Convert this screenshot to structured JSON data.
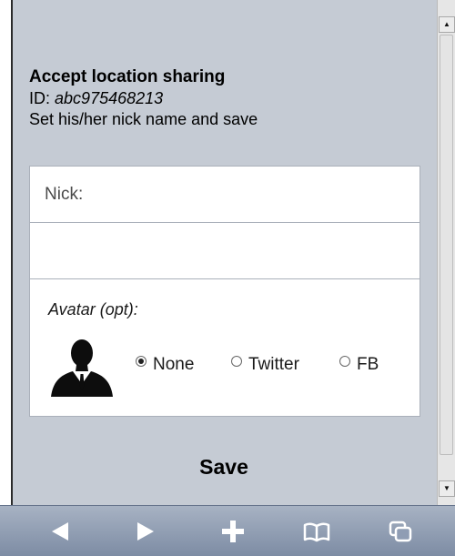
{
  "dialog": {
    "title": "Accept location sharing",
    "id_label": "ID:",
    "id_value": "abc975468213",
    "instruction": "Set his/her nick name and save"
  },
  "form": {
    "nick_label": "Nick:",
    "nick_value": "",
    "avatar_label": "Avatar (opt):",
    "avatar_options": [
      {
        "label": "None",
        "selected": true
      },
      {
        "label": "Twitter",
        "selected": false
      },
      {
        "label": "FB",
        "selected": false
      }
    ]
  },
  "actions": {
    "save_label": "Save"
  },
  "toolbar": {
    "icons": [
      "back-icon",
      "forward-icon",
      "add-icon",
      "bookmarks-icon",
      "tabs-icon"
    ]
  },
  "colors": {
    "page_background": "#c5cbd4",
    "panel_background": "#ffffff",
    "toolbar_gradient_top": "#a7b2c3",
    "toolbar_gradient_bottom": "#7d8ca4"
  }
}
